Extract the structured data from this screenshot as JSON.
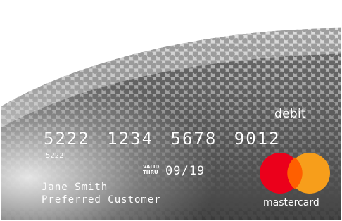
{
  "card": {
    "type_label": "debit",
    "number": "5222 1234 5678 9012",
    "number_short": "5222",
    "valid_thru_label_1": "VALID",
    "valid_thru_label_2": "THRU",
    "expiry": "09/19",
    "holder_name": "Jane Smith",
    "holder_title": "Preferred Customer",
    "brand": "mastercard"
  },
  "colors": {
    "mc_red": "#eb001b",
    "mc_orange": "#f79e1b",
    "mc_overlap": "#ff5f00"
  },
  "icons": {
    "brand_logo": "mastercard-logo-icon"
  }
}
